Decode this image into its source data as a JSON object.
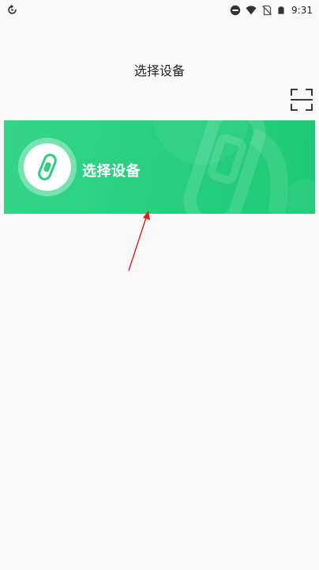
{
  "status_bar": {
    "time": "9:31",
    "icons": [
      "sync-icon",
      "do-not-disturb-icon",
      "wifi-icon",
      "no-sim-icon",
      "battery-icon"
    ]
  },
  "header": {
    "title": "选择设备",
    "scan_icon": "scan-icon"
  },
  "banner": {
    "label": "选择设备",
    "icon": "fitness-band-icon",
    "color": "#27cf7f"
  },
  "annotation": {
    "type": "arrow",
    "color": "#e02020"
  }
}
